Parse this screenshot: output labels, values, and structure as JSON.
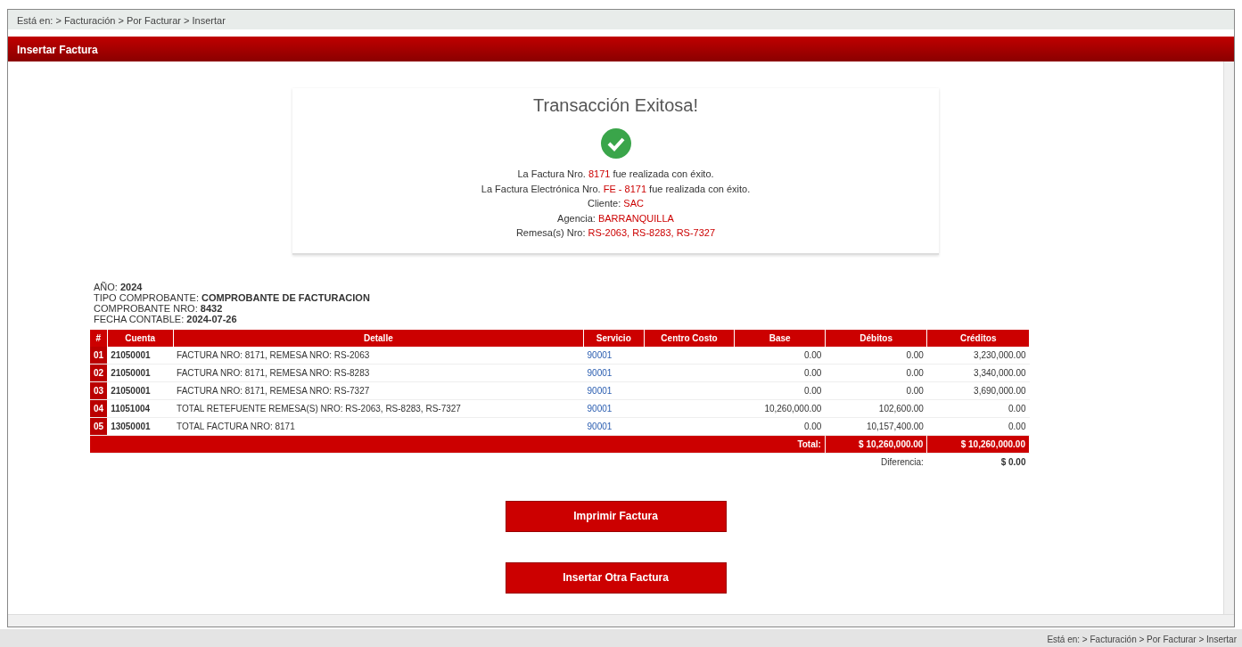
{
  "breadcrumb": "Está en: > Facturación > Por Facturar > Insertar",
  "header": {
    "title": "Insertar Factura"
  },
  "success": {
    "title": "Transacción Exitosa!",
    "lines": [
      {
        "label": "La Factura Nro.",
        "value": "8171",
        "suffix": "fue realizada con éxito."
      },
      {
        "label": "La Factura Electrónica Nro.",
        "value": "FE - 8171",
        "suffix": "fue realizada con éxito."
      },
      {
        "label": "Cliente:",
        "value": "SAC"
      },
      {
        "label": "Agencia:",
        "value": "BARRANQUILLA"
      },
      {
        "label": "Remesa(s) Nro:",
        "value": "RS-2063, RS-8283, RS-7327"
      }
    ]
  },
  "voucher": [
    {
      "label": "AÑO:",
      "value": "2024"
    },
    {
      "label": "TIPO COMPROBANTE:",
      "value": "COMPROBANTE DE FACTURACION"
    },
    {
      "label": "COMPROBANTE NRO:",
      "value": "8432"
    },
    {
      "label": "FECHA CONTABLE:",
      "value": "2024-07-26"
    }
  ],
  "table": {
    "columns": [
      "#",
      "Cuenta",
      "Detalle",
      "Servicio",
      "Centro Costo",
      "Base",
      "Débitos",
      "Créditos"
    ],
    "rows": [
      [
        "01",
        "21050001",
        "FACTURA NRO: 8171, REMESA NRO: RS-2063",
        "90001",
        "",
        "0.00",
        "0.00",
        "3,230,000.00"
      ],
      [
        "02",
        "21050001",
        "FACTURA NRO: 8171, REMESA NRO: RS-8283",
        "90001",
        "",
        "0.00",
        "0.00",
        "3,340,000.00"
      ],
      [
        "03",
        "21050001",
        "FACTURA NRO: 8171, REMESA NRO: RS-7327",
        "90001",
        "",
        "0.00",
        "0.00",
        "3,690,000.00"
      ],
      [
        "04",
        "11051004",
        "TOTAL RETEFUENTE REMESA(S) NRO: RS-2063, RS-8283, RS-7327",
        "90001",
        "",
        "10,260,000.00",
        "102,600.00",
        "0.00"
      ],
      [
        "05",
        "13050001",
        "TOTAL FACTURA NRO: 8171",
        "90001",
        "",
        "0.00",
        "10,157,400.00",
        "0.00"
      ]
    ],
    "total_label": "Total:",
    "total_debits": "$ 10,260,000.00",
    "total_credits": "$ 10,260,000.00",
    "difference_label": "Diferencia:",
    "difference": "$ 0.00"
  },
  "buttons": [
    "Imprimir Factura",
    "Insertar Otra Factura"
  ],
  "status_bar": "Está en: > Facturación > Por Facturar > Insertar"
}
